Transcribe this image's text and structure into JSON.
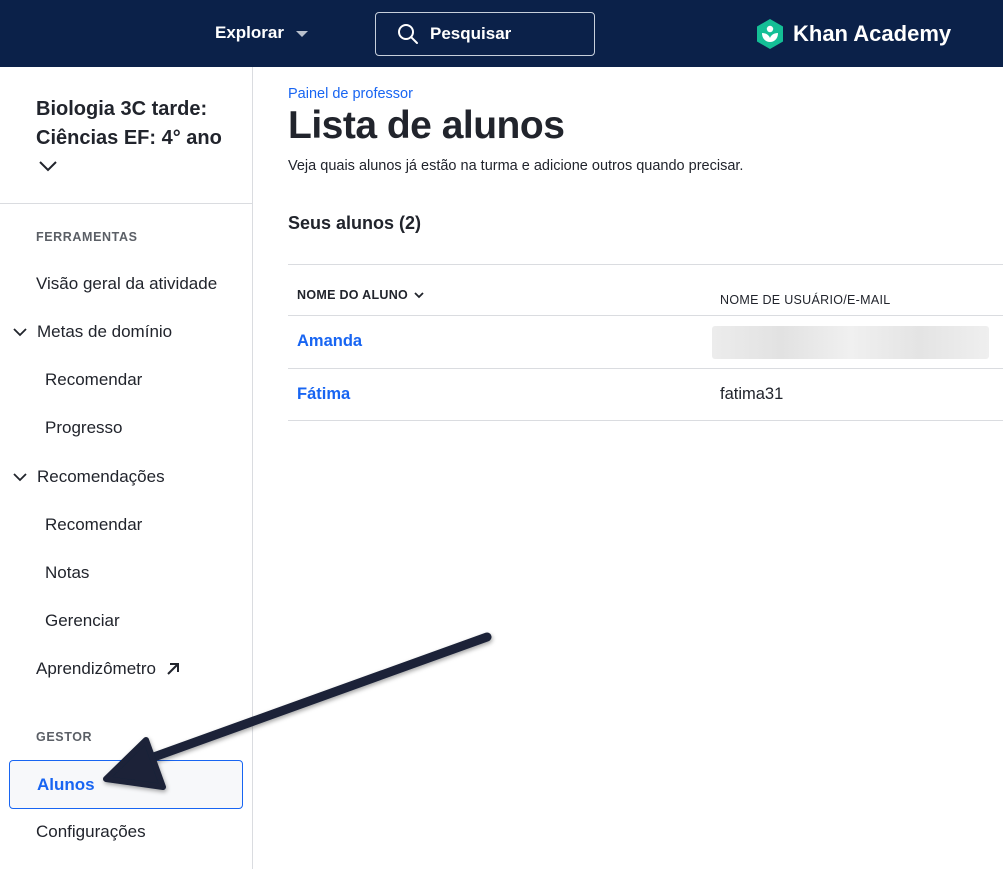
{
  "topbar": {
    "explore_label": "Explorar",
    "search_label": "Pesquisar",
    "logo_text": "Khan Academy"
  },
  "sidebar": {
    "class_title": "Biologia 3C tarde: Ciências EF: 4° ano",
    "tools_section": "FERRAMENTAS",
    "items": {
      "activity_overview": "Visão geral da atividade",
      "mastery_goals": "Metas de domínio",
      "mastery_recommend": "Recomendar",
      "mastery_progress": "Progresso",
      "recommendations": "Recomendações",
      "rec_recommend": "Recomendar",
      "rec_grades": "Notas",
      "rec_manage": "Gerenciar",
      "learnometer": "Aprendizômetro"
    },
    "manager_section": "GESTOR",
    "manager_items": {
      "students": "Alunos",
      "settings": "Configurações"
    }
  },
  "main": {
    "breadcrumb": "Painel de professor",
    "title": "Lista de alunos",
    "description": "Veja quais alunos já estão na turma e adicione outros quando precisar.",
    "students_count": "Seus alunos (2)",
    "table": {
      "headers": {
        "name": "NOME DO ALUNO",
        "username": "NOME DE USUÁRIO/E-MAIL"
      },
      "rows": [
        {
          "name": "Amanda",
          "username": ""
        },
        {
          "name": "Fátima",
          "username": "fatima31"
        }
      ]
    }
  },
  "colors": {
    "topbar_bg": "#0b2149",
    "accent": "#1865f2",
    "logo_green": "#14bf96",
    "annotation_arrow": "#1a2238"
  }
}
